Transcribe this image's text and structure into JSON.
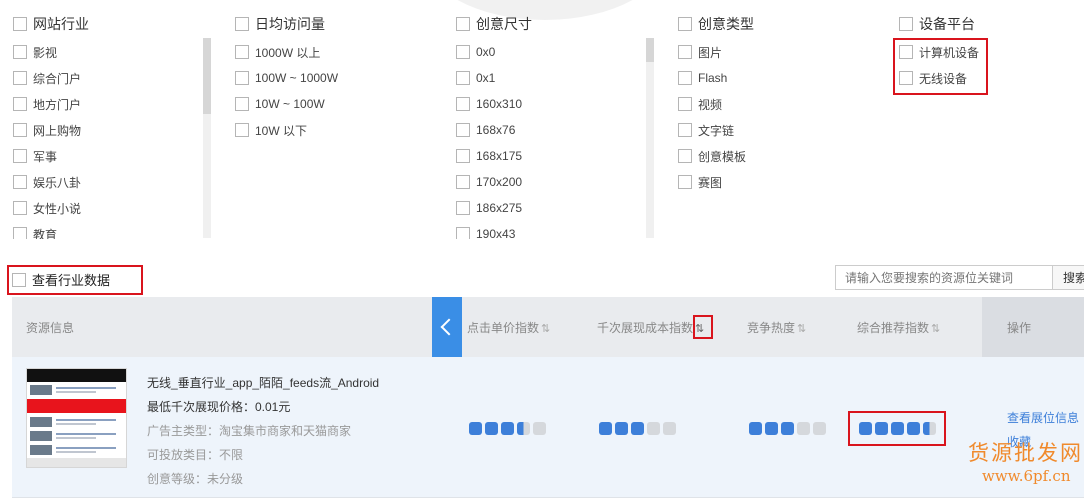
{
  "filters": {
    "industry": {
      "title": "网站行业",
      "options": [
        "影视",
        "综合门户",
        "地方门户",
        "网上购物",
        "军事",
        "娱乐八卦",
        "女性小说",
        "教育"
      ]
    },
    "daily_visits": {
      "title": "日均访问量",
      "options": [
        "1000W 以上",
        "100W ~ 1000W",
        "10W ~ 100W",
        "10W 以下"
      ]
    },
    "creative_size": {
      "title": "创意尺寸",
      "options": [
        "0x0",
        "0x1",
        "160x310",
        "168x76",
        "168x175",
        "170x200",
        "186x275",
        "190x43"
      ]
    },
    "creative_type": {
      "title": "创意类型",
      "options": [
        "图片",
        "Flash",
        "视频",
        "文字链",
        "创意模板",
        "赛图"
      ]
    },
    "device_platform": {
      "title": "设备平台",
      "options": [
        "计算机设备",
        "无线设备"
      ]
    }
  },
  "industry_data_toggle": "查看行业数据",
  "search": {
    "placeholder": "请输入您要搜索的资源位关键词",
    "button": "搜索"
  },
  "table": {
    "headers": {
      "resource": "资源信息",
      "click_price": "点击单价指数",
      "cpm": "千次展现成本指数",
      "competition": "竞争热度",
      "recommend": "综合推荐指数",
      "operation": "操作"
    },
    "sort_icon": "⇅",
    "rows": [
      {
        "title": "无线_垂直行业_app_陌陌_feeds流_Android",
        "price": "最低千次展现价格：0.01元",
        "advertiser": "广告主类型：淘宝集市商家和天猫商家",
        "category": "可投放类目：不限",
        "level": "创意等级：未分级",
        "click_price_index": 3.5,
        "cpm_index": 3,
        "competition_index": 3,
        "recommend_index": 4.5,
        "actions": [
          "查看展位信息",
          "收藏"
        ]
      }
    ]
  },
  "watermark": {
    "title": "货源批发网",
    "sub": "www.6pf.cn"
  },
  "colors": {
    "accent": "#3d7fd9",
    "highlight": "#d9141d",
    "header_bg": "#e9ebee",
    "row_bg": "#eef4fb",
    "watermark": "#f08a2c"
  }
}
